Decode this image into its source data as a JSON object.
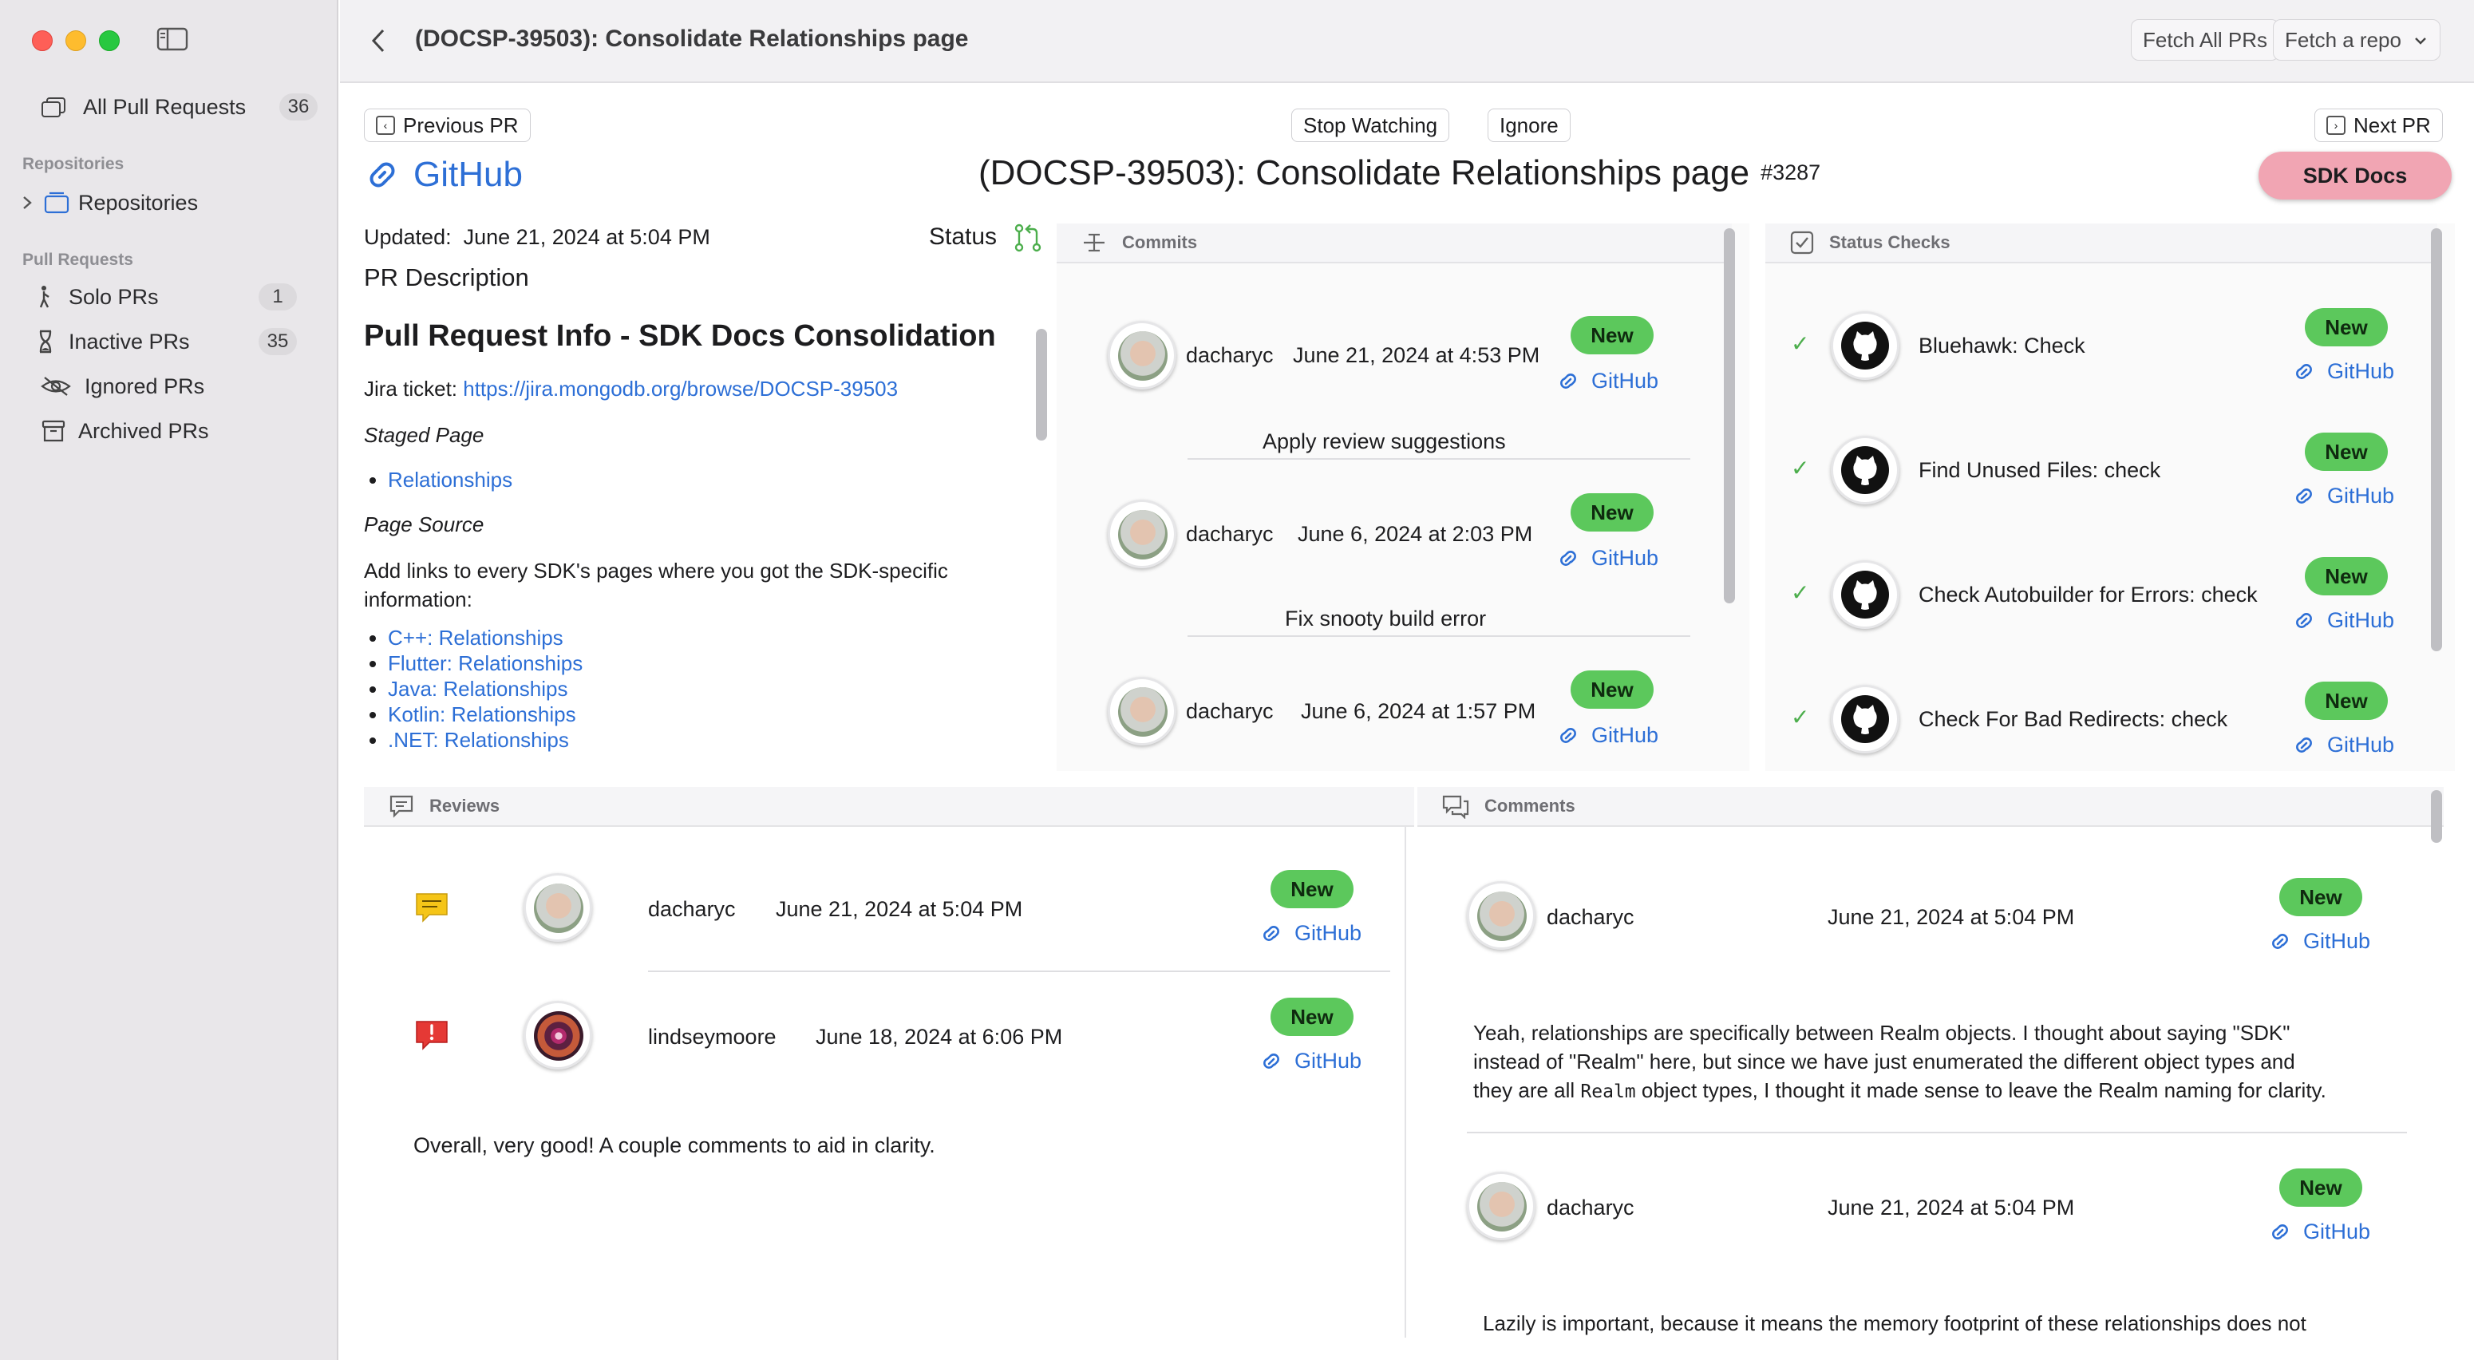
{
  "window": {
    "title": "(DOCSP-39503): Consolidate Relationships page"
  },
  "toolbar": {
    "fetch_all": "Fetch All PRs",
    "fetch_repo": "Fetch a repo"
  },
  "sidebar": {
    "all_prs": {
      "label": "All Pull Requests",
      "count": "36"
    },
    "repos_header": "Repositories",
    "repos_item": "Repositories",
    "prs_header": "Pull Requests",
    "items": [
      {
        "label": "Solo PRs",
        "count": "1"
      },
      {
        "label": "Inactive PRs",
        "count": "35"
      },
      {
        "label": "Ignored PRs"
      },
      {
        "label": "Archived PRs"
      }
    ]
  },
  "nav": {
    "prev": "Previous PR",
    "stop": "Stop Watching",
    "ignore": "Ignore",
    "next": "Next PR"
  },
  "header": {
    "github": "GitHub",
    "title": "(DOCSP-39503): Consolidate Relationships page",
    "number": "#3287",
    "repo_badge": "SDK Docs"
  },
  "details": {
    "updated_label": "Updated:",
    "updated_value": "June 21, 2024 at 5:04 PM",
    "status_label": "Status",
    "desc_label": "PR Description"
  },
  "description": {
    "heading": "Pull Request Info - SDK Docs Consolidation",
    "jira_prefix": "Jira ticket: ",
    "jira_link": "https://jira.mongodb.org/browse/DOCSP-39503",
    "staged_label": "Staged Page",
    "staged_link": "Relationships",
    "source_label": "Page Source",
    "source_text": "Add links to every SDK's pages where you got the SDK-specific information:",
    "source_links": [
      "C++: Relationships",
      "Flutter: Relationships",
      "Java: Relationships",
      "Kotlin: Relationships",
      ".NET: Relationships"
    ]
  },
  "commits": {
    "header": "Commits",
    "items": [
      {
        "author": "dacharyc",
        "date": "June 21, 2024 at 4:53 PM",
        "badge": "New",
        "link": "GitHub",
        "message": "Apply review suggestions"
      },
      {
        "author": "dacharyc",
        "date": "June 6, 2024 at 2:03 PM",
        "badge": "New",
        "link": "GitHub",
        "message": "Fix snooty build error"
      },
      {
        "author": "dacharyc",
        "date": "June 6, 2024 at 1:57 PM",
        "badge": "New",
        "link": "GitHub",
        "message": ""
      }
    ]
  },
  "checks": {
    "header": "Status Checks",
    "items": [
      {
        "name": "Bluehawk: Check",
        "badge": "New",
        "link": "GitHub"
      },
      {
        "name": "Find Unused Files: check",
        "badge": "New",
        "link": "GitHub"
      },
      {
        "name": "Check Autobuilder for Errors: check",
        "badge": "New",
        "link": "GitHub"
      },
      {
        "name": "Check For Bad Redirects: check",
        "badge": "New",
        "link": "GitHub"
      }
    ]
  },
  "reviews": {
    "header": "Reviews",
    "items": [
      {
        "author": "dacharyc",
        "date": "June 21, 2024 at 5:04 PM",
        "badge": "New",
        "link": "GitHub",
        "state_icon": "comment-icon",
        "state_color": "#f5c518"
      },
      {
        "author": "lindseymoore",
        "date": "June 18, 2024 at 6:06 PM",
        "badge": "New",
        "link": "GitHub",
        "state_icon": "changes-requested-icon",
        "state_color": "#e53935"
      }
    ],
    "body": "Overall, very good! A couple comments to aid in clarity."
  },
  "comments": {
    "header": "Comments",
    "items": [
      {
        "author": "dacharyc",
        "date": "June 21, 2024 at 5:04 PM",
        "badge": "New",
        "link": "GitHub",
        "body_1": "Yeah, relationships are specifically between Realm objects. I thought about saying \"SDK\"",
        "body_2": "instead of \"Realm\" here, but since we have just enumerated the different object types and",
        "body_3a": "they are all ",
        "body_code": "Realm",
        "body_3b": " object types, I thought it made sense to leave the Realm naming for clarity."
      },
      {
        "author": "dacharyc",
        "date": "June 21, 2024 at 5:04 PM",
        "badge": "New",
        "link": "GitHub",
        "body_1": "Lazily is important, because it means the memory footprint of these relationships does not"
      }
    ]
  },
  "colors": {
    "accent": "#2d6fd6",
    "new_badge": "#5cc85c",
    "repo_badge": "#f1a5b3",
    "check": "#4cae4c"
  }
}
